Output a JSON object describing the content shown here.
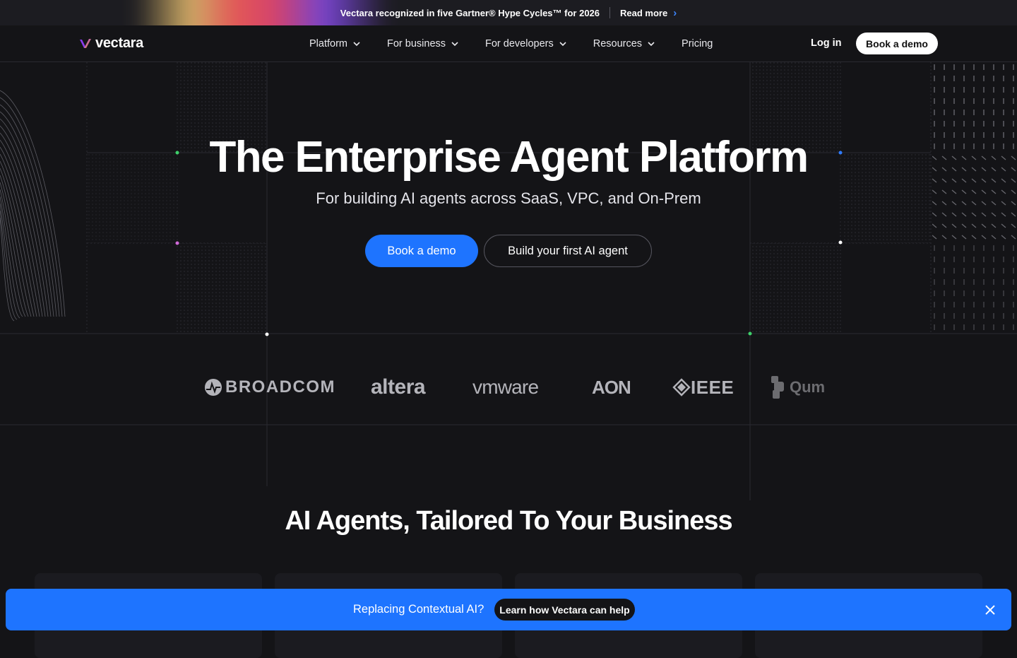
{
  "announcement": {
    "text": "Vectara recognized in five Gartner® Hype Cycles™ for 2026",
    "link_label": "Read more",
    "icon": "chevron-right-icon"
  },
  "brand": {
    "name": "vectara",
    "logo_icon": "vectara-logo-icon"
  },
  "nav": {
    "items": [
      {
        "label": "Platform",
        "has_dropdown": true
      },
      {
        "label": "For business",
        "has_dropdown": true
      },
      {
        "label": "For developers",
        "has_dropdown": true
      },
      {
        "label": "Resources",
        "has_dropdown": true
      },
      {
        "label": "Pricing",
        "has_dropdown": false
      }
    ],
    "login_label": "Log in",
    "demo_label": "Book a demo"
  },
  "hero": {
    "title": "The Enterprise Agent Platform",
    "subtitle": "For building AI agents across SaaS, VPC, and On-Prem",
    "primary_cta": "Book a demo",
    "secondary_cta": "Build your first AI agent"
  },
  "clients": [
    {
      "name": "BROADCOM",
      "logo": "broadcom-logo"
    },
    {
      "name": "altera",
      "logo": "altera-logo"
    },
    {
      "name": "vmware",
      "logo": "vmware-logo"
    },
    {
      "name": "AON",
      "logo": "aon-logo"
    },
    {
      "name": "IEEE",
      "logo": "ieee-logo"
    },
    {
      "name": "Qum",
      "logo": "qum-logo"
    }
  ],
  "section": {
    "title": "AI Agents, Tailored To Your Business"
  },
  "banner": {
    "text": "Replacing Contextual AI?",
    "cta": "Learn how Vectara can help",
    "close_icon": "close-icon"
  },
  "colors": {
    "background": "#141417",
    "accent": "#1e74ff",
    "text": "#ffffff"
  }
}
